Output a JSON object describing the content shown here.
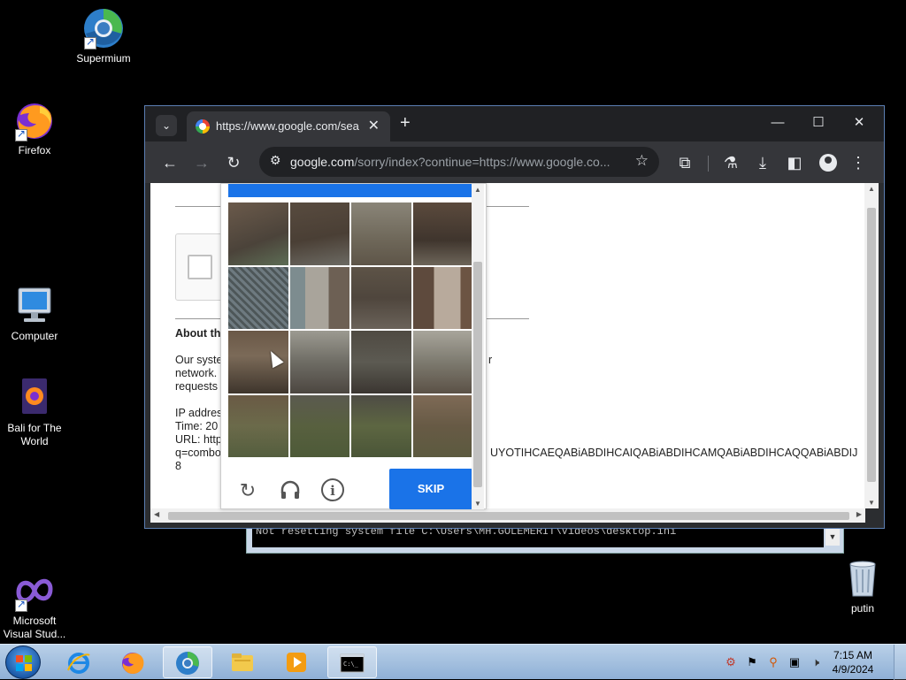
{
  "desktop": {
    "icons": [
      {
        "label": "Supermium"
      },
      {
        "label": "Firefox"
      },
      {
        "label": "Computer"
      },
      {
        "label": "Bali for The World"
      },
      {
        "label": "Microsoft Visual Stud..."
      },
      {
        "label": "putin"
      }
    ]
  },
  "console": {
    "text": "Not resetting system file    C:\\Users\\MH.GOLEMERIT\\Videos\\desktop.ini"
  },
  "browser": {
    "tab_title": "https://www.google.com/search",
    "url_host": "google.com",
    "url_rest": "/sorry/index?continue=https://www.google.co...",
    "page": {
      "about_heading": "About th",
      "para_line1": "Our syste",
      "para_line1_end": "r",
      "para_line2": "network.",
      "para_line3": "requests",
      "ip_label": "IP addres",
      "time_label": "Time: 20",
      "url_label": "URL: http",
      "q_label": "q=combo",
      "q_tail": "UYOTIHCAEQABiABDIHCAIQABiABDIHCAMQABiABDIHCAQQABiABDIJ",
      "eight": "8"
    },
    "captcha": {
      "skip_label": "SKIP",
      "reload_icon": "reload-icon",
      "audio_icon": "headphones-icon",
      "info_icon": "info-icon"
    }
  },
  "taskbar": {
    "clock_time": "7:15 AM",
    "clock_date": "4/9/2024"
  }
}
